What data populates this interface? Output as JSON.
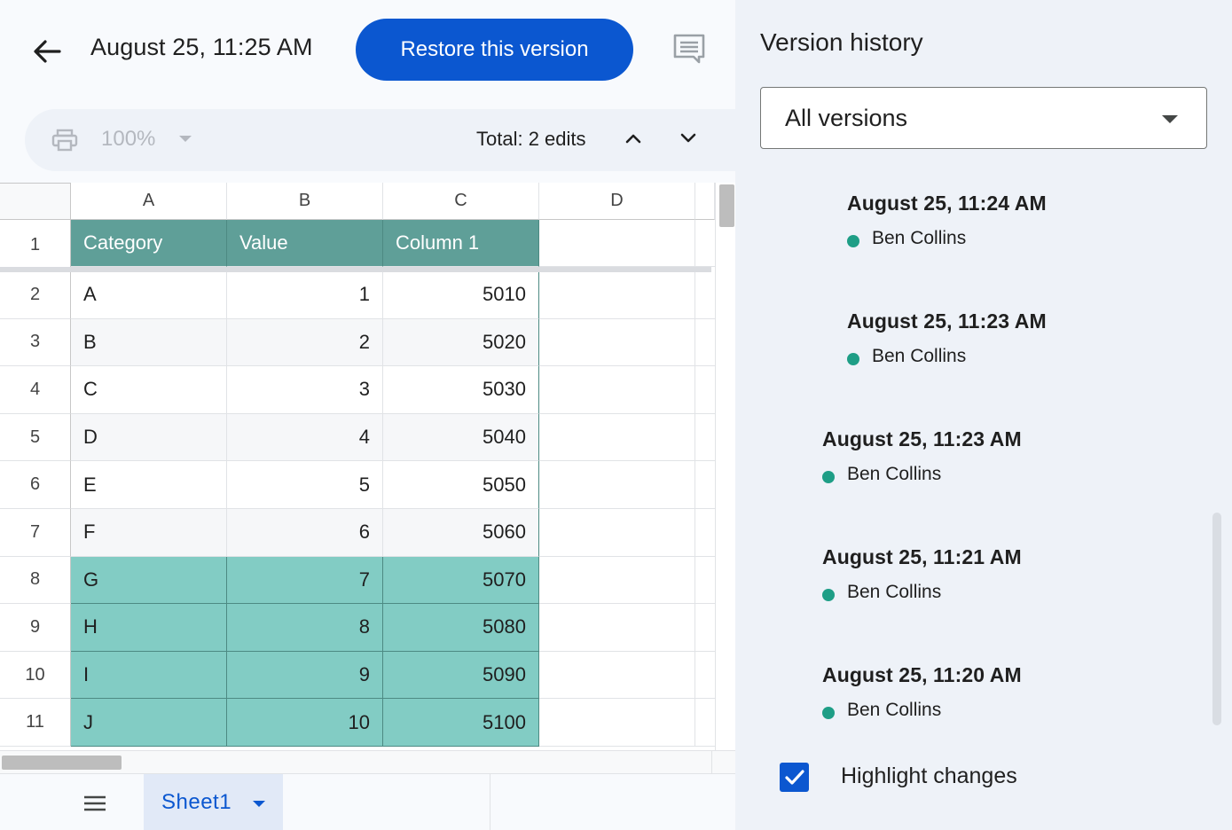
{
  "header": {
    "version_title": "August 25, 11:25 AM",
    "restore_label": "Restore this version",
    "back_icon": "arrow-left-icon",
    "comment_icon": "comment-icon"
  },
  "toolbar": {
    "print_icon": "print-icon",
    "zoom": "100%",
    "edits": "Total: 2 edits",
    "up_icon": "chevron-up-icon",
    "down_icon": "chevron-down-icon"
  },
  "grid": {
    "columns": [
      "A",
      "B",
      "C",
      "D"
    ],
    "header_row": [
      "Category",
      "Value",
      "Column 1"
    ],
    "row_numbers": [
      "1",
      "2",
      "3",
      "4",
      "5",
      "6",
      "7",
      "8",
      "9",
      "10",
      "11"
    ],
    "rows": [
      [
        "A",
        "1",
        "5010"
      ],
      [
        "B",
        "2",
        "5020"
      ],
      [
        "C",
        "3",
        "5030"
      ],
      [
        "D",
        "4",
        "5040"
      ],
      [
        "E",
        "5",
        "5050"
      ],
      [
        "F",
        "6",
        "5060"
      ],
      [
        "G",
        "7",
        "5070"
      ],
      [
        "H",
        "8",
        "5080"
      ],
      [
        "I",
        "9",
        "5090"
      ],
      [
        "J",
        "10",
        "5100"
      ]
    ],
    "highlighted_rows": [
      6,
      7,
      8,
      9
    ],
    "colors": {
      "header": "#5f9f98",
      "highlight": "#82ccc4",
      "band": "#f6f7f9"
    }
  },
  "sheetbar": {
    "menu_icon": "hamburger-menu-icon",
    "active_sheet": "Sheet1"
  },
  "panel": {
    "title": "Version history",
    "filter": "All versions",
    "versions": [
      {
        "time": "August 25, 11:24 AM",
        "author": "Ben Collins"
      },
      {
        "time": "August 25, 11:23 AM",
        "author": "Ben Collins"
      },
      {
        "time": "August 25, 11:23 AM",
        "author": "Ben Collins"
      },
      {
        "time": "August 25, 11:21 AM",
        "author": "Ben Collins"
      },
      {
        "time": "August 25, 11:20 AM",
        "author": "Ben Collins"
      }
    ],
    "highlight_label": "Highlight changes",
    "highlight_checked": true,
    "accent": "#0b57d0",
    "author_dot": "#1e9e86"
  }
}
